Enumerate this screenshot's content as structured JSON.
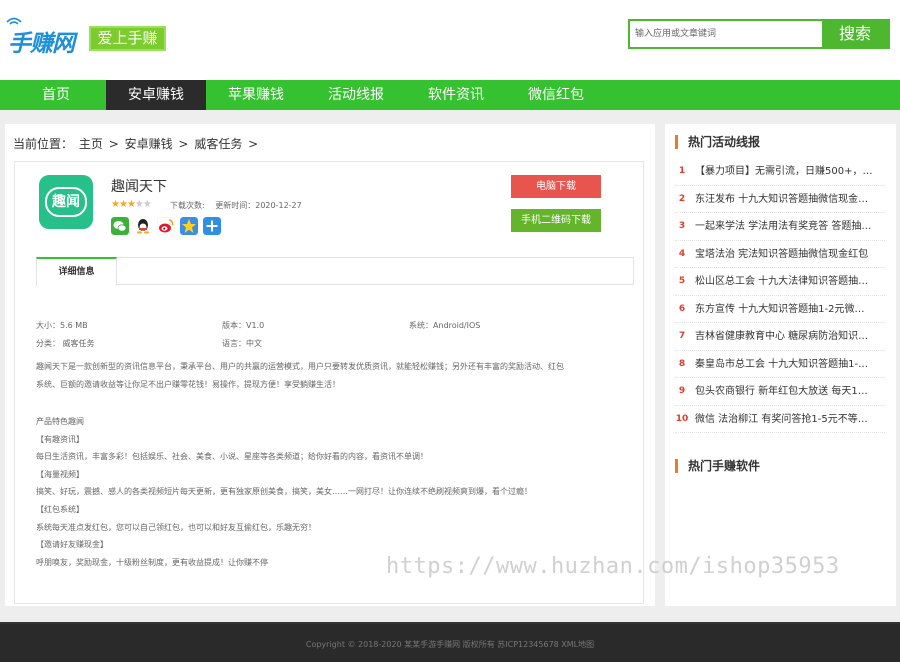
{
  "header": {
    "logo_text": "手赚网",
    "slogan": "爱上手赚",
    "search_placeholder": "输入应用或文章键词",
    "search_button": "搜索"
  },
  "nav": {
    "items": [
      "首页",
      "安卓赚钱",
      "苹果赚钱",
      "活动线报",
      "软件资讯",
      "微信红包"
    ],
    "active_index": 1
  },
  "breadcrumb": {
    "label": "当前位置：",
    "items": [
      "主页",
      ">",
      "安卓赚钱",
      ">",
      "威客任务",
      ">"
    ]
  },
  "app": {
    "icon_text": "趣闻",
    "title": "趣闻天下",
    "rating": 3,
    "rating_max": 5,
    "download_count_label": "下载次数:",
    "update_time_label": "更新时间：2020-12-27",
    "share_icons": [
      "wechat-icon",
      "qq-icon",
      "weibo-icon",
      "qzone-icon",
      "more-share-icon"
    ],
    "btn_pc": "电脑下载",
    "btn_qr": "手机二维码下载",
    "tab_label": "详细信息",
    "info": {
      "size": "大小：5.6 MB",
      "version": "版本：V1.0",
      "system": "系统：Android/IOS",
      "category": "分类：  威客任务",
      "language": "语言：中文"
    },
    "description": [
      "趣闻天下是一款创新型的资讯信息平台，秉承平台、用户的共赢的运营模式，用户只要转发优质资讯，就能轻松赚钱；另外还有丰富的奖励活动、红包",
      "系统、巨额的邀请收益等让你足不出户赚零花钱！易操作，提现方便！享受躺赚生活！"
    ],
    "features": [
      "产品特色趣闻",
      "【有趣资讯】",
      "每日生活资讯，丰富多彩！包括娱乐、社会、美食、小说、星座等各类频道；给你好看的内容，看资讯不单调！",
      "【海量视频】",
      "搞笑、好玩，震撼、感人的各类视频短片每天更新，更有独家原创美食，搞笑，美女……一网打尽！让你连续不绝刷视频爽到爆，看个过瘾！",
      "【红包系统】",
      "系统每天准点发红包，您可以自己领红包，也可以和好友互偷红包，乐趣无穷！",
      "【邀请好友赚现金】",
      "呼朋唤友，奖励现金，十级粉丝制度，更有收益提成！让你赚不停"
    ]
  },
  "sidebar": {
    "hot_title": "热门活动线报",
    "hot_items": [
      "【暴力项目】无需引流，日赚500+，…",
      "东汪发布 十九大知识答题抽微信现金…",
      "一起来学法 学法用法有奖竞答 答题抽…",
      "宝塔法治 宪法知识答题抽微信现金红包",
      "松山区总工会 十九大法律知识答题抽…",
      "东方宣传 十九大知识答题抽1-2元微…",
      "吉林省健康教育中心 糖尿病防治知识…",
      "秦皇岛市总工会 十九大知识答题抽1-…",
      "包头农商银行 新年红包大放送 每天1…",
      "微信 法治柳江 有奖问答抢1-5元不等…"
    ],
    "soft_title": "热门手赚软件"
  },
  "watermark": "https://www.huzhan.com/ishop35953",
  "footer": {
    "text": "Copyright © 2018-2020 某某手游手赚网 版权所有 苏ICP12345678 XML地图"
  },
  "colors": {
    "brand_green": "#36c131",
    "nav_active": "#2b2b2b",
    "download_red": "#e8554e",
    "qr_green": "#64b52c",
    "rank_red": "#e23b2e",
    "title_accent": "#ee7a22"
  }
}
